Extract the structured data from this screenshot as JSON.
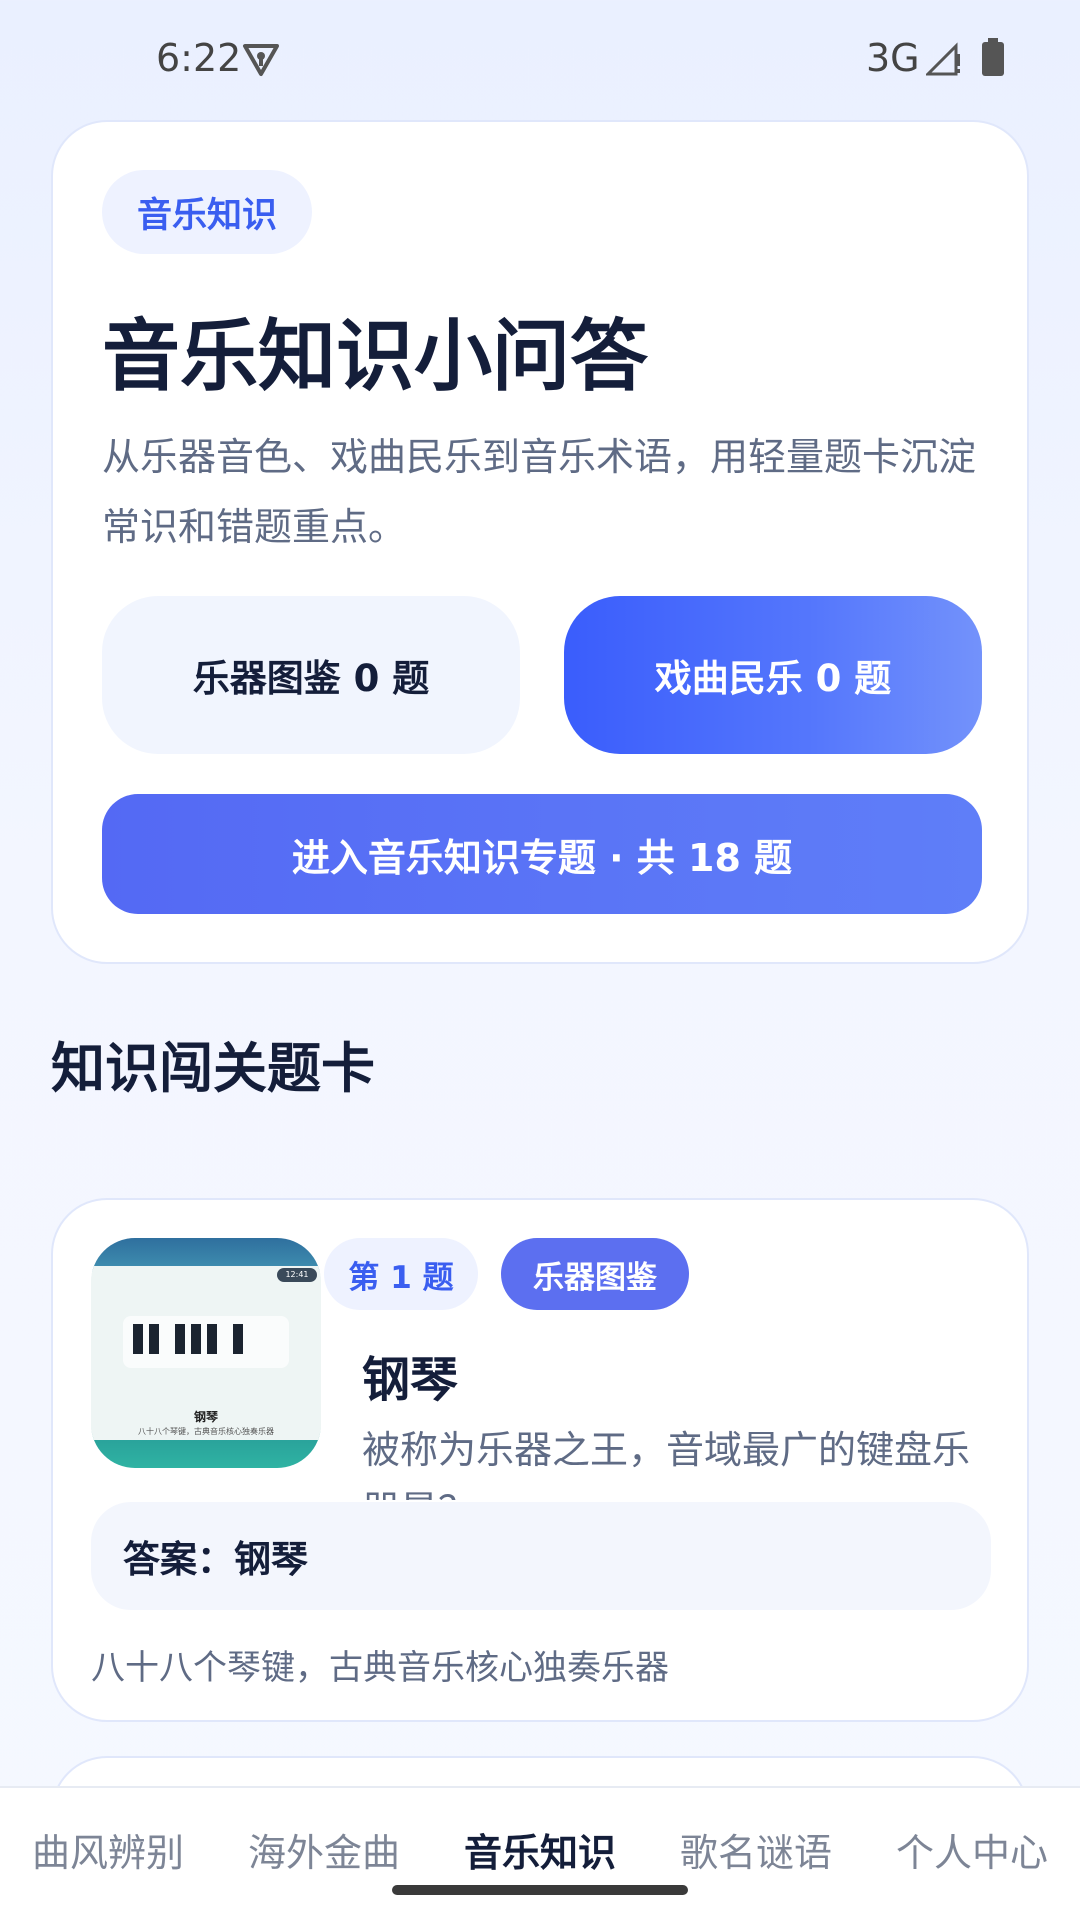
{
  "status_bar": {
    "time": "6:22",
    "network": "3G"
  },
  "hero": {
    "tag": "音乐知识",
    "title": "音乐知识小问答",
    "description": "从乐器音色、戏曲民乐到音乐术语，用轻量题卡沉淀常识和错题重点。",
    "btn_instrument": "乐器图鉴 0 题",
    "btn_opera": "戏曲民乐 0 题",
    "btn_enter": "进入音乐知识专题 · 共 18 题"
  },
  "section": {
    "title": "知识闯关题卡"
  },
  "question_card": {
    "number": "第 1 题",
    "category": "乐器图鉴",
    "title": "钢琴",
    "question": "被称为乐器之王，音域最广的键盘乐器是？",
    "answer": "答案：钢琴",
    "note": "八十八个琴键，古典音乐核心独奏乐器",
    "thumb": {
      "clock": "12:41",
      "name": "钢琴",
      "sub": "八十八个琴键，古典音乐核心独奏乐器"
    }
  },
  "bottom_nav": {
    "tabs": [
      "曲风辨别",
      "海外金曲",
      "音乐知识",
      "歌名谜语",
      "个人中心"
    ],
    "active_index": 2
  },
  "colors": {
    "accent": "#3a5ef0",
    "title": "#141e3a",
    "muted": "#5f6b85"
  }
}
